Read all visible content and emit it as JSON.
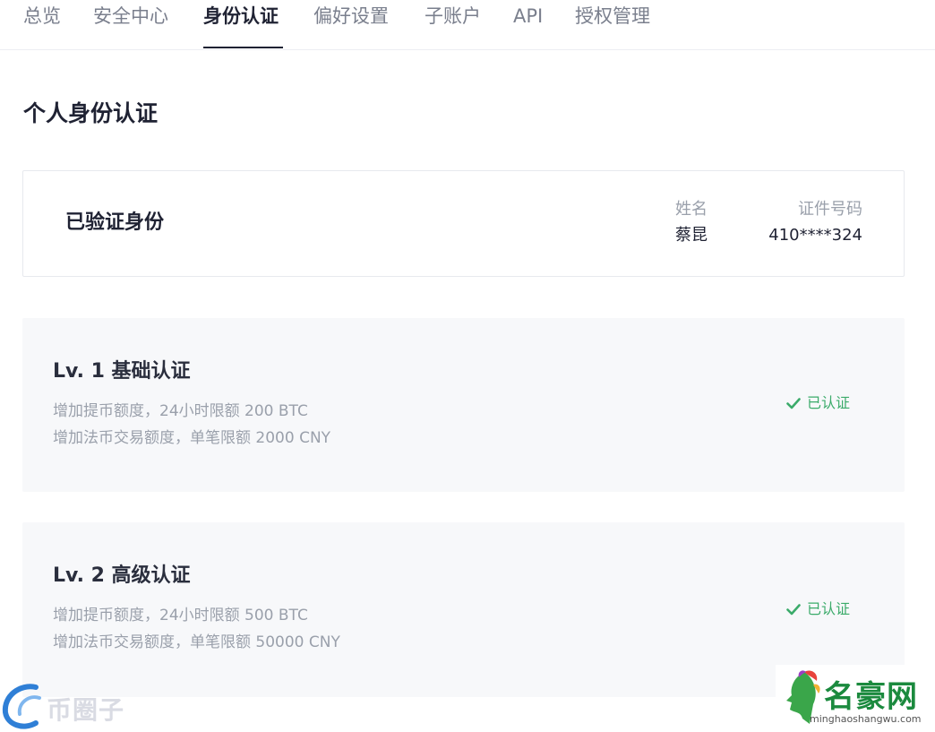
{
  "tabs": [
    {
      "label": "总览"
    },
    {
      "label": "安全中心"
    },
    {
      "label": "身份认证"
    },
    {
      "label": "偏好设置"
    },
    {
      "label": "子账户"
    },
    {
      "label": "API"
    },
    {
      "label": "授权管理"
    }
  ],
  "section_title": "个人身份认证",
  "verified": {
    "title": "已验证身份",
    "name_label": "姓名",
    "name_value": "蔡昆",
    "id_label": "证件号码",
    "id_value": "410****324"
  },
  "levels": [
    {
      "title": "Lv. 1 基础认证",
      "desc1": "增加提币额度，24小时限额 200 BTC",
      "desc2": "增加法币交易额度，单笔限额 2000 CNY",
      "status": "已认证"
    },
    {
      "title": "Lv. 2 高级认证",
      "desc1": "增加提币额度，24小时限额 500 BTC",
      "desc2": "增加法币交易额度，单笔限额 50000 CNY",
      "status": "已认证"
    }
  ],
  "watermarks": {
    "left_text": "币圈子",
    "right_name": "名豪网",
    "right_url": "minghaoshangwu.com"
  },
  "colors": {
    "accent_green": "#3bab6a",
    "text_primary": "#1f2233",
    "text_muted": "#9aa0ab",
    "card_bg": "#f7f8fa"
  }
}
